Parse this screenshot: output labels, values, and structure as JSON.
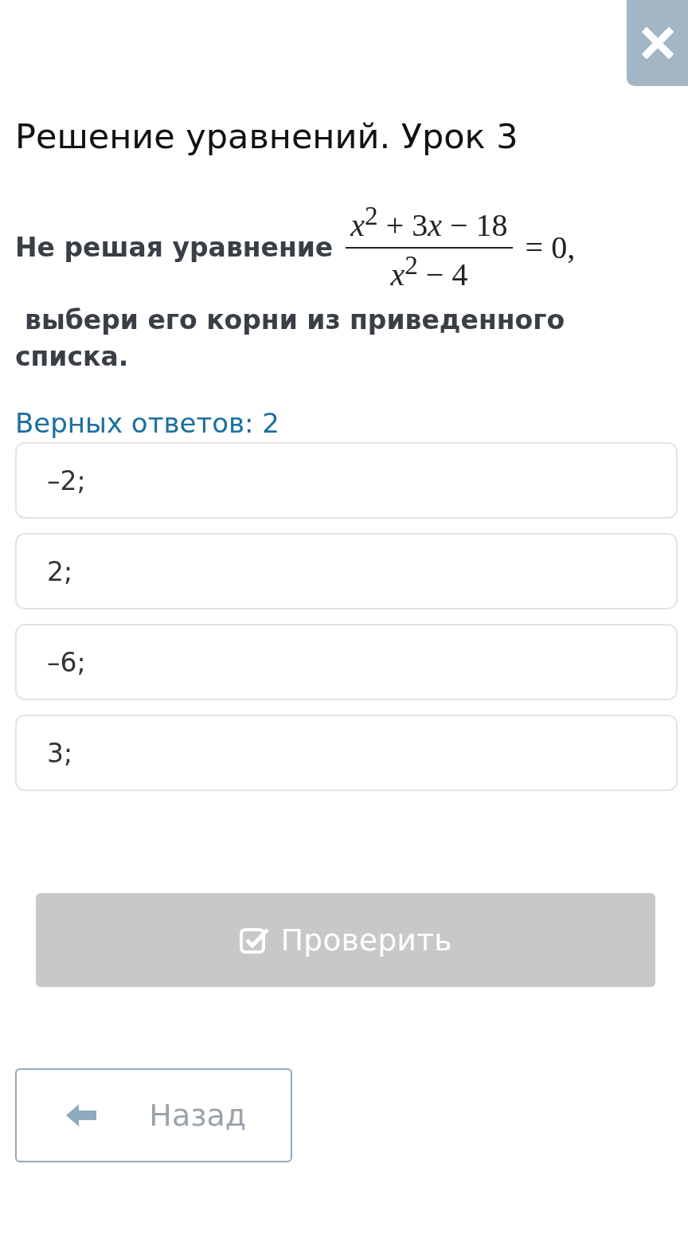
{
  "title": "Решение уравнений. Урок 3",
  "question": {
    "lead": "Не решая уравнение",
    "numerator": [
      "*x*$^{2}$ + 3",
      "*x*",
      " − 18"
    ],
    "denominator": "*x*$^{2}$ − 4",
    "tail": "= 0,",
    "rest": "выбери его корни из приведенного списка."
  },
  "answers_hint": "Верных ответов: 2",
  "options": [
    {
      "label": "–2;",
      "selected": false
    },
    {
      "label": "2;",
      "selected": false
    },
    {
      "label": "–6;",
      "selected": false
    },
    {
      "label": "3;",
      "selected": false
    }
  ],
  "check_button": {
    "label": "Проверить",
    "disabled": true
  },
  "back_button": {
    "label": "Назад"
  }
}
